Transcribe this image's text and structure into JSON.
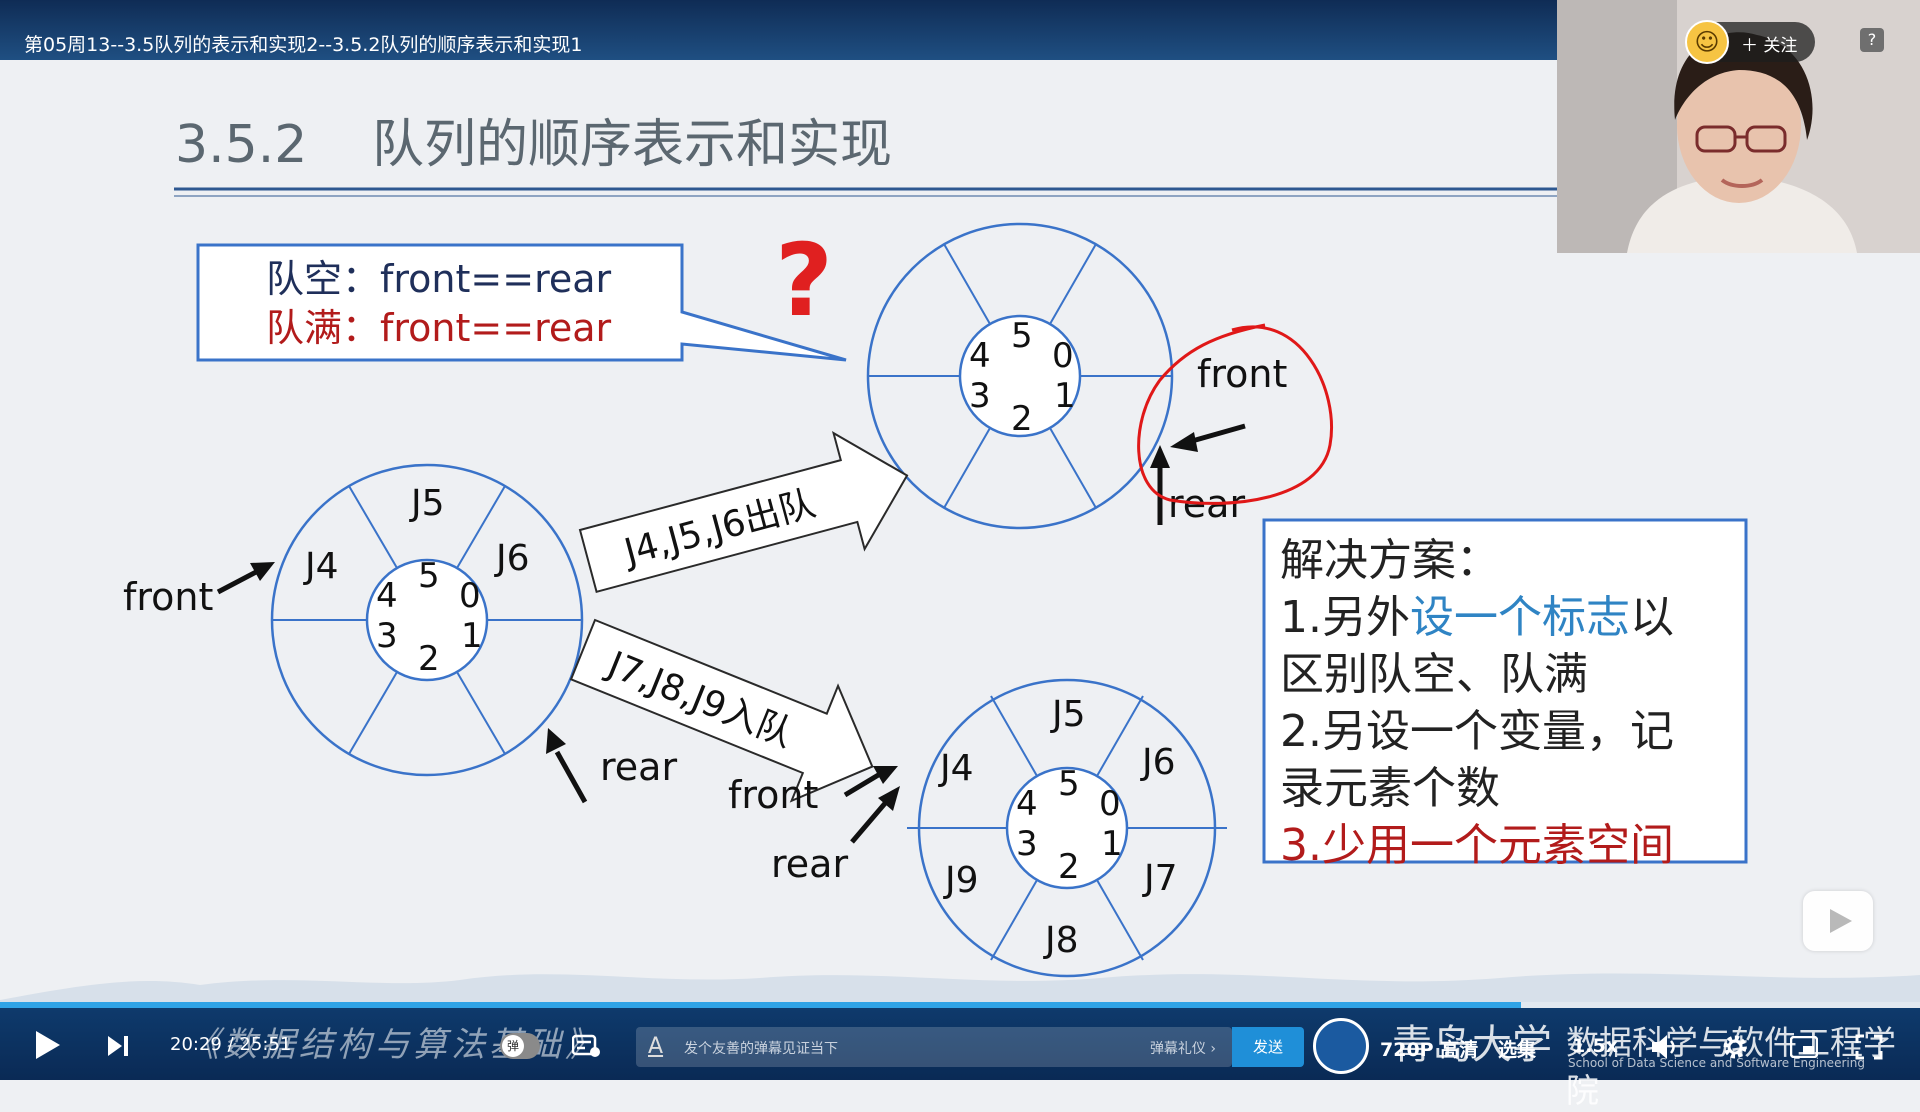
{
  "window": {
    "title": "第05周13--3.5队列的表示和实现2--3.5.2队列的顺序表示和实现1"
  },
  "slide": {
    "heading_number": "3.5.2",
    "heading_text": "队列的顺序表示和实现",
    "callout": {
      "line1": "队空：front==rear",
      "line2": "队满：front==rear"
    },
    "question_mark": "?",
    "top_ring": {
      "indices": [
        "5",
        "0",
        "1",
        "2",
        "3",
        "4"
      ],
      "front_label": "front",
      "rear_label": "rear"
    },
    "left_ring": {
      "indices": [
        "5",
        "0",
        "1",
        "2",
        "3",
        "4"
      ],
      "cells": [
        "J5",
        "J6",
        "J4"
      ],
      "front_label": "front",
      "rear_label": "rear"
    },
    "bottom_ring": {
      "indices": [
        "5",
        "0",
        "1",
        "2",
        "3",
        "4"
      ],
      "cells": [
        "J5",
        "J6",
        "J7",
        "J8",
        "J9",
        "J4"
      ],
      "front_label": "front",
      "rear_label": "rear"
    },
    "arrow_dequeue_label": "J4,J5,J6出队",
    "arrow_enqueue_label": "J7,J8,J9入队",
    "solution": {
      "title": "解决方案：",
      "item1_prefix": "1.另外",
      "item1_highlight": "设一个标志",
      "item1_suffix": "以",
      "item1_line2": "区别队空、队满",
      "item2_line1": "2.另设一个变量，记",
      "item2_line2": "录元素个数",
      "item3": "3.少用一个元素空间"
    },
    "colors": {
      "blue": "#3a73c9",
      "red": "#b21b1b",
      "text": "#222222",
      "highlight": "#2f84c4"
    }
  },
  "webcam": {
    "follow_label": "关注",
    "help_label": "?"
  },
  "player": {
    "time_current": "20:29",
    "time_separator": "/",
    "time_total": "25:51",
    "progress_fraction": 0.792,
    "course_banner": "《数据结构与算法基础》",
    "danmaku_toggle_label": "弹",
    "danmaku_placeholder": "发个友善的弹幕见证当下",
    "danmaku_etiquette": "弹幕礼仪 ›",
    "send_label": "发送",
    "university_name": "青岛大学",
    "quality_label": "720P 高清",
    "select_episode_label": "选集",
    "school_name": "数据科学与软件工程学院",
    "school_name_en": "School of Data Science and Software Engineering",
    "speed_label": "1.5x"
  }
}
